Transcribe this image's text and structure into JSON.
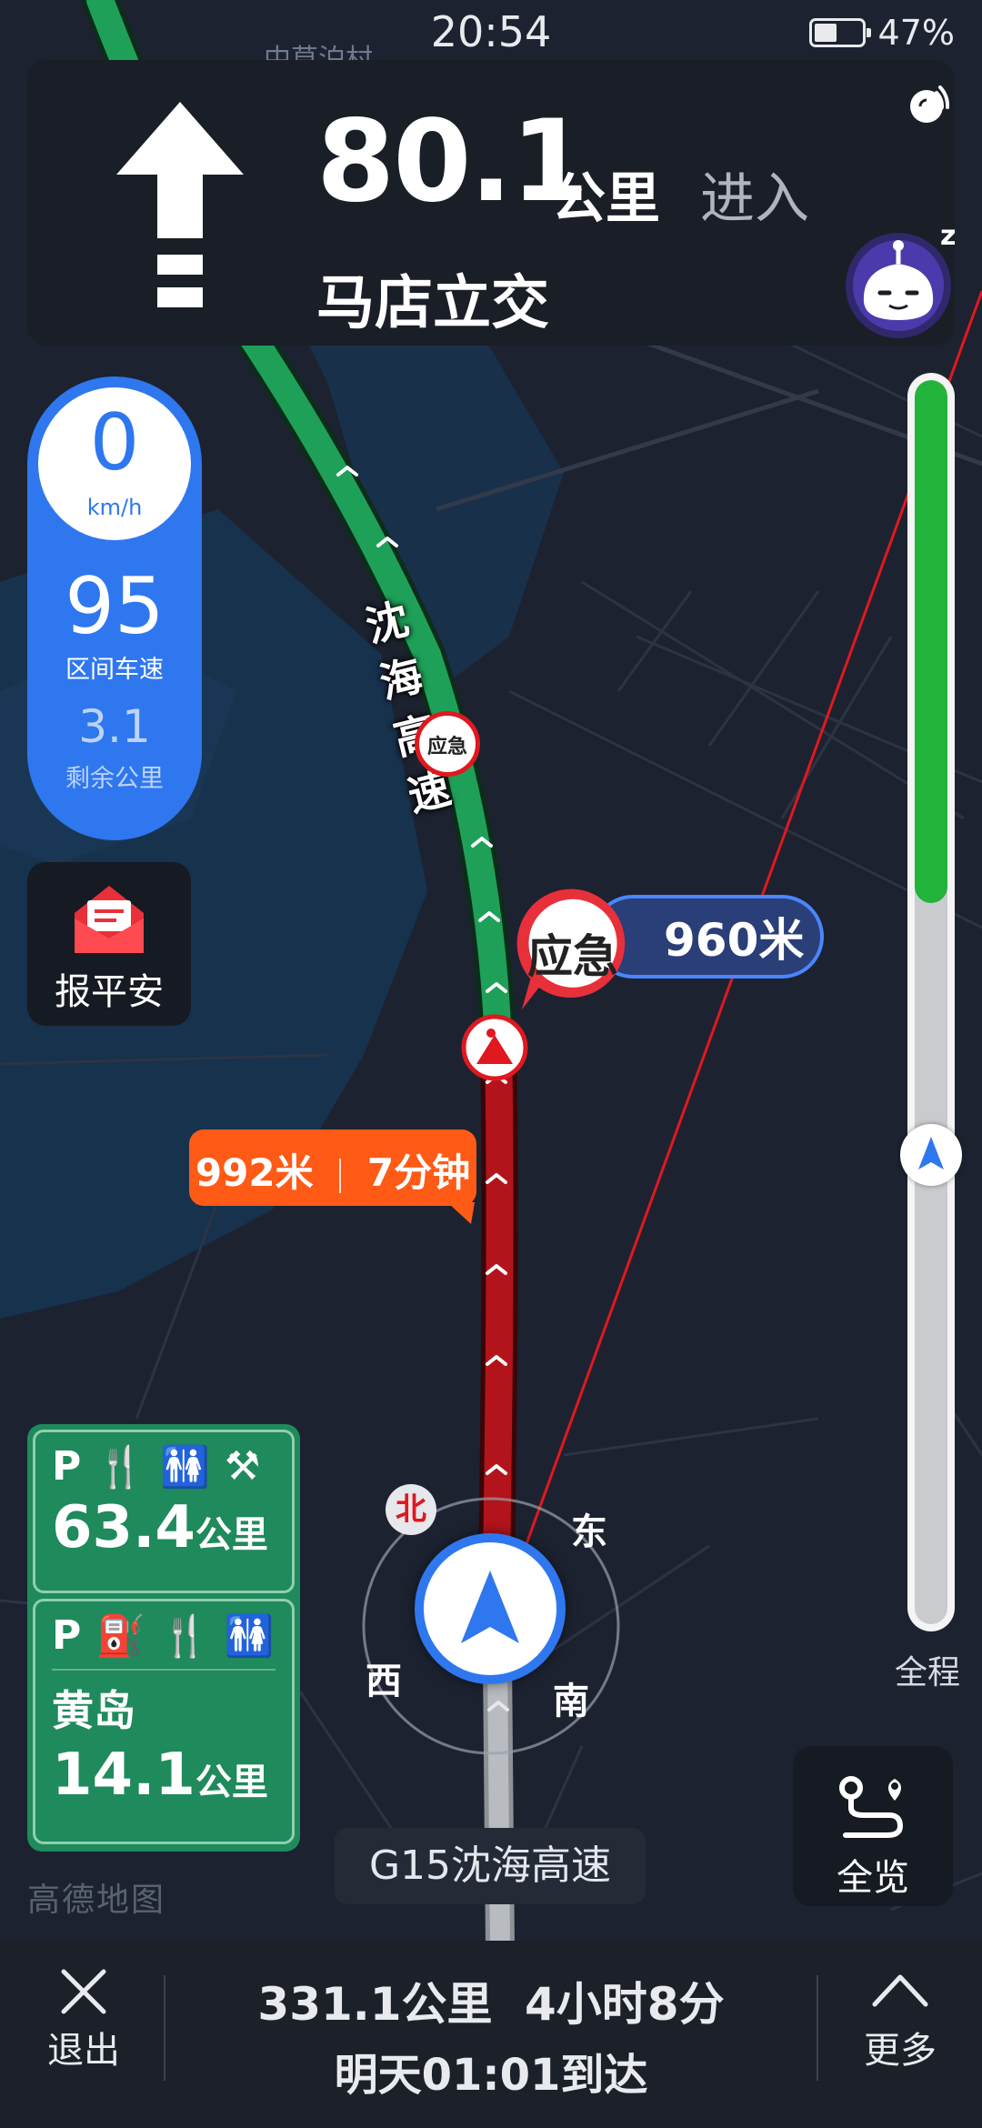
{
  "status_bar": {
    "time": "20:54",
    "battery": "47%",
    "battery_level": 0.47
  },
  "map": {
    "top_place": "中草泊村"
  },
  "guide": {
    "distance": "80.1",
    "unit": "公里",
    "action": "进入",
    "road": "马店立交",
    "maneuver_icon": "straight-arrow-icon",
    "voice_icon": "sound-icon",
    "assistant_icon": "robot-assistant-icon",
    "assistant_badge": "z"
  },
  "speed": {
    "current": "0",
    "current_unit": "km/h",
    "avg": "95",
    "avg_label": "区间车速",
    "remaining": "3.1",
    "remaining_label": "剩余公里"
  },
  "safety": {
    "label": "报平安",
    "icon": "envelope-icon"
  },
  "route_label": "沈海高速",
  "emergency": {
    "label": "应急",
    "distance": "960米",
    "small_label": "应急"
  },
  "congestion": {
    "distance": "992米",
    "time": "7分钟"
  },
  "progress": {
    "label": "全程",
    "fraction": 0.42,
    "colors": {
      "done": "#22b33a",
      "remaining": "#c9cbcf"
    }
  },
  "compass": {
    "north": "北",
    "east": "东",
    "south": "南",
    "west": "西"
  },
  "service": {
    "area1": {
      "icons": [
        "P",
        "fork-knife-icon",
        "restroom-icon",
        "repair-icon"
      ],
      "distance": "63.4",
      "unit": "公里"
    },
    "area2": {
      "icons": [
        "P",
        "fuel-icon",
        "fork-knife-icon",
        "restroom-icon"
      ],
      "name": "黄岛",
      "distance": "14.1",
      "unit": "公里"
    }
  },
  "map_logo": "高德地图",
  "current_road": "G15沈海高速",
  "overview": {
    "label": "全览"
  },
  "bottom": {
    "exit_label": "退出",
    "trip_distance": "331.1公里",
    "trip_time": "4小时8分",
    "arrival": "明天01:01到达",
    "more_label": "更多"
  },
  "colors": {
    "accent": "#2f77ee",
    "route_green": "#1fa058",
    "route_red": "#b3141b",
    "callout_orange": "#ff5a16",
    "service_green": "#1f8a5c"
  }
}
